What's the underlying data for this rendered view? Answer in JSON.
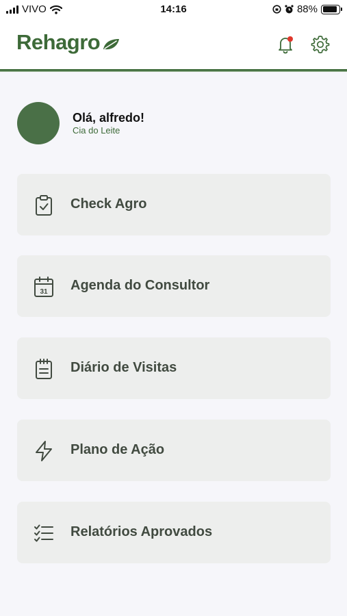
{
  "status_bar": {
    "carrier": "VIVO",
    "time": "14:16",
    "battery_percent": "88%",
    "battery_level": 0.88
  },
  "header": {
    "brand": "Rehagro",
    "brand_color": "#3d6a38",
    "notification_dot_color": "#e0372b"
  },
  "profile": {
    "greeting": "Olá, alfredo!",
    "company": "Cia do Leite"
  },
  "menu": [
    {
      "label": "Check Agro",
      "icon": "clipboard-check-icon"
    },
    {
      "label": "Agenda do Consultor",
      "icon": "calendar-31-icon"
    },
    {
      "label": "Diário de Visitas",
      "icon": "notepad-icon"
    },
    {
      "label": "Plano de Ação",
      "icon": "lightning-icon"
    },
    {
      "label": "Relatórios Aprovados",
      "icon": "checklist-icon"
    }
  ]
}
